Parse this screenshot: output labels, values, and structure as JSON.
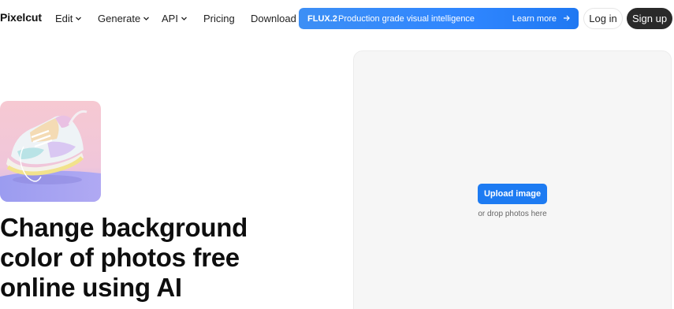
{
  "nav": {
    "logo": "Pixelcut",
    "items": [
      {
        "label": "Edit",
        "has_dropdown": true
      },
      {
        "label": "Generate",
        "has_dropdown": true
      },
      {
        "label": "API",
        "has_dropdown": true
      },
      {
        "label": "Pricing",
        "has_dropdown": false
      },
      {
        "label": "Download",
        "has_dropdown": false
      }
    ],
    "login_label": "Log in",
    "signup_label": "Sign up"
  },
  "banner": {
    "tag": "FLUX.2",
    "message": "Production grade visual intelligence",
    "cta": "Learn more",
    "icon": "arrow-right-icon",
    "color": "#2f86ff"
  },
  "hero": {
    "image_icon": "sneaker-image",
    "headline": [
      "Change background",
      "color of photos free",
      "online using AI"
    ]
  },
  "uploader": {
    "button_label": "Upload image",
    "hint": "or drop photos here",
    "accent": "#1d7bf2"
  }
}
